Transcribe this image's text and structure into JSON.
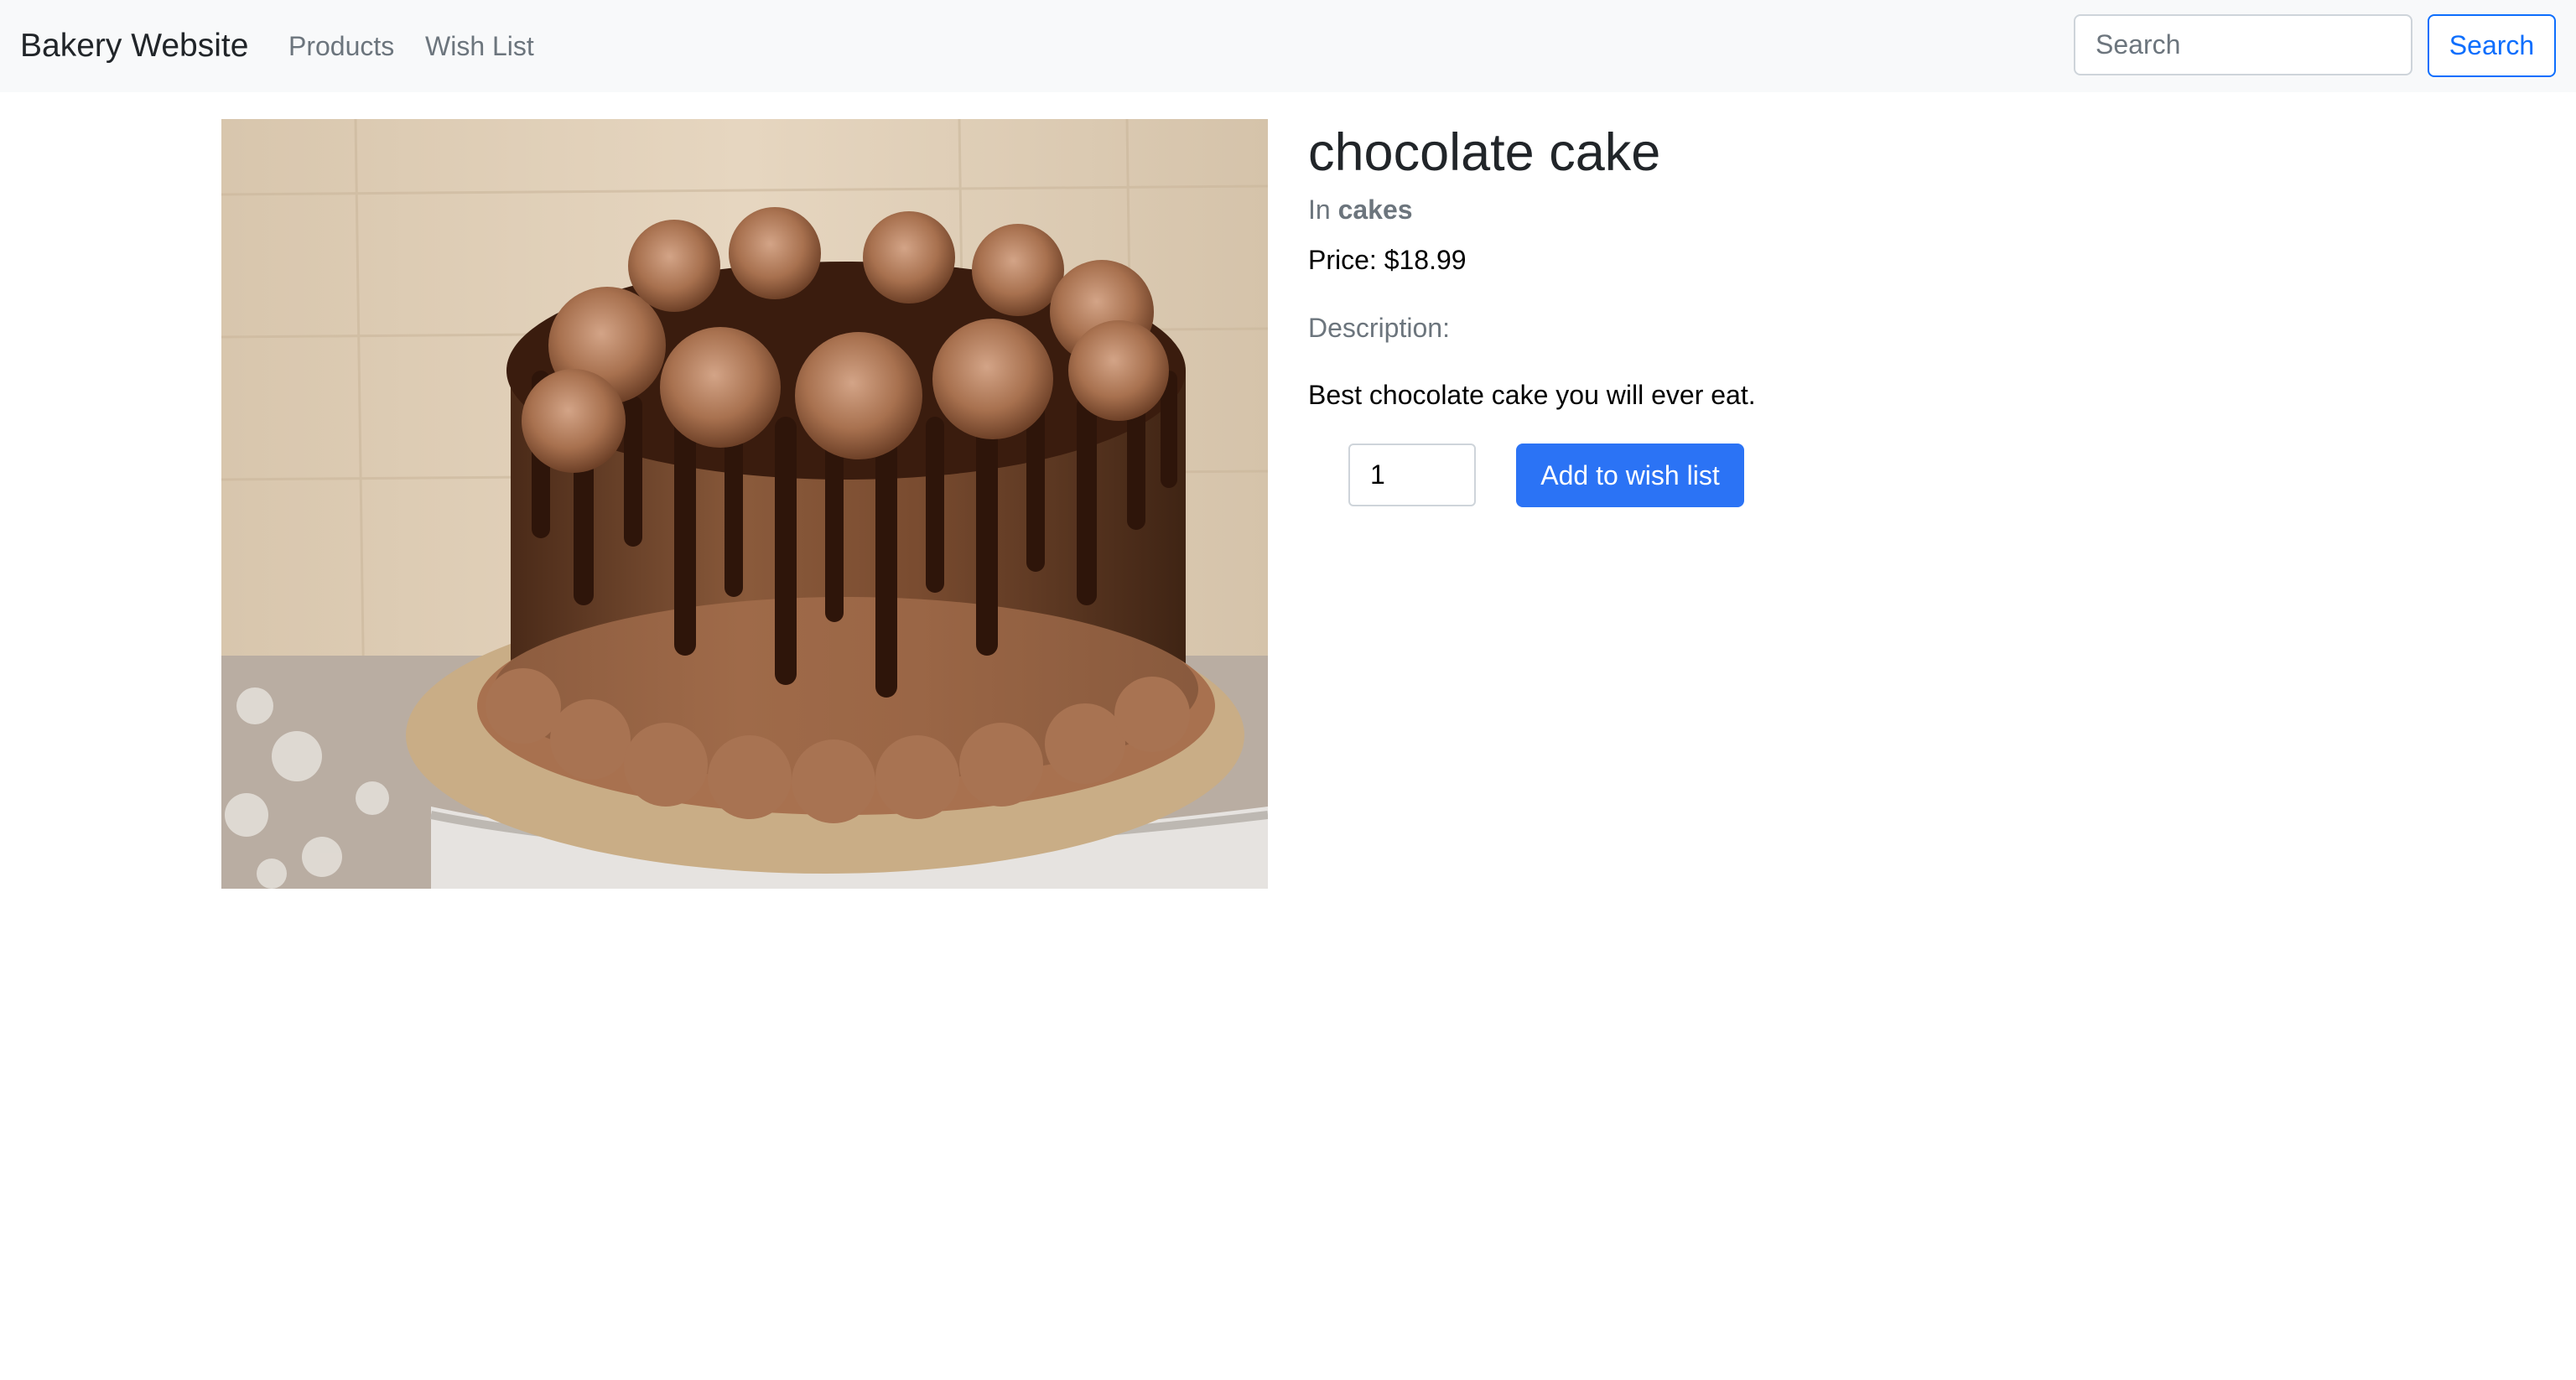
{
  "navbar": {
    "brand": "Bakery Website",
    "links": [
      {
        "label": "Products"
      },
      {
        "label": "Wish List"
      }
    ],
    "search": {
      "placeholder": "Search",
      "value": "",
      "button_label": "Search"
    }
  },
  "product": {
    "name": "chocolate cake",
    "category_prefix": "In",
    "category": "cakes",
    "price_line": "Price: $18.99",
    "description_label": "Description:",
    "description": "Best chocolate cake you will ever eat.",
    "quantity": "1",
    "add_button_label": "Add to wish list",
    "image_icon": "chocolate-cake-photo"
  },
  "colors": {
    "primary": "#0d6efd",
    "button_fill": "#2b73f5",
    "navbar_bg": "#f8f9fa",
    "muted_text": "#6c757d"
  }
}
